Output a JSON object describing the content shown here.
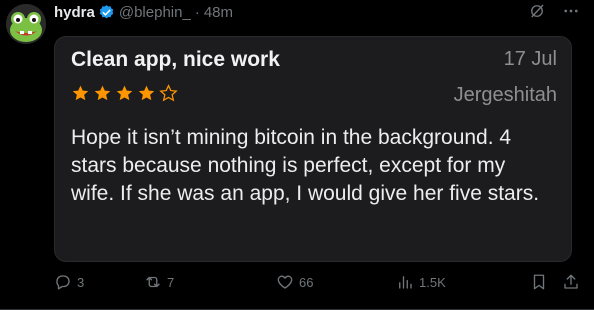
{
  "tweet": {
    "display_name": "hydra",
    "handle": "@blephin_",
    "separator": "·",
    "time": "48m"
  },
  "review": {
    "title": "Clean app, nice work",
    "date": "17 Jul",
    "author": "Jergeshitah",
    "rating": 4,
    "max_rating": 5,
    "star_color": "#ff9500",
    "body": "Hope it isn’t mining bitcoin in the background. 4 stars because nothing is perfect, except for my wife. If she was an app, I would give her five stars."
  },
  "actions": {
    "replies": "3",
    "reposts": "7",
    "likes": "66",
    "views": "1.5K"
  },
  "icons": [
    "avatar-frog",
    "verified-badge-icon",
    "grok-icon",
    "more-icon",
    "reply-icon",
    "repost-icon",
    "like-icon",
    "views-icon",
    "bookmark-icon",
    "share-icon"
  ],
  "colors": {
    "verified": "#1d9bf0",
    "text_muted": "#71767b",
    "card_bg": "#1c1c1e"
  }
}
